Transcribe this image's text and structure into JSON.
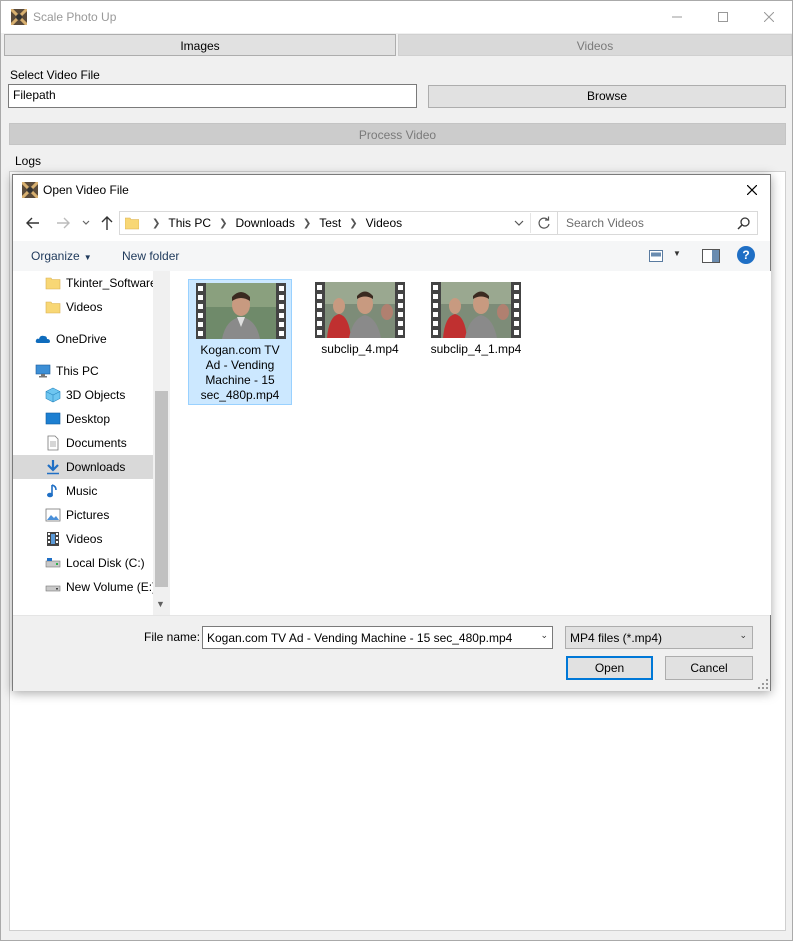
{
  "app": {
    "title": "Scale Photo Up",
    "tabs": [
      "Images",
      "Videos"
    ],
    "select_label": "Select Video File",
    "filepath_value": "Filepath",
    "browse_label": "Browse",
    "process_label": "Process Video",
    "logs_label": "Logs"
  },
  "dialog": {
    "title": "Open Video File",
    "breadcrumbs": [
      "This PC",
      "Downloads",
      "Test",
      "Videos"
    ],
    "search_placeholder": "Search Videos",
    "organize_label": "Organize",
    "new_folder_label": "New folder",
    "nav_items": [
      {
        "label": "Tkinter_Software",
        "icon": "folder-icon"
      },
      {
        "label": "Videos",
        "icon": "folder-icon"
      },
      {
        "label": "OneDrive",
        "icon": "onedrive-icon"
      },
      {
        "label": "This PC",
        "icon": "pc-icon"
      },
      {
        "label": "3D Objects",
        "icon": "3d-objects-icon"
      },
      {
        "label": "Desktop",
        "icon": "desktop-icon"
      },
      {
        "label": "Documents",
        "icon": "documents-icon"
      },
      {
        "label": "Downloads",
        "icon": "downloads-icon",
        "selected": true
      },
      {
        "label": "Music",
        "icon": "music-icon"
      },
      {
        "label": "Pictures",
        "icon": "pictures-icon"
      },
      {
        "label": "Videos",
        "icon": "videos-icon"
      },
      {
        "label": "Local Disk (C:)",
        "icon": "local-disk-icon"
      },
      {
        "label": "New Volume (E:)",
        "icon": "drive-icon"
      }
    ],
    "files": [
      {
        "name": "Kogan.com TV Ad - Vending Machine - 15 sec_480p.mp4",
        "selected": true
      },
      {
        "name": "subclip_4.mp4"
      },
      {
        "name": "subclip_4_1.mp4"
      }
    ],
    "file_name_label": "File name:",
    "file_name_value": "Kogan.com TV Ad - Vending Machine - 15 sec_480p.mp4",
    "file_type_value": "MP4 files (*.mp4)",
    "open_label": "Open",
    "cancel_label": "Cancel"
  },
  "colors": {
    "accent": "#0078d7",
    "selection": "#cce8ff",
    "selection_border": "#99d1ff",
    "link_text": "#1e395b"
  }
}
